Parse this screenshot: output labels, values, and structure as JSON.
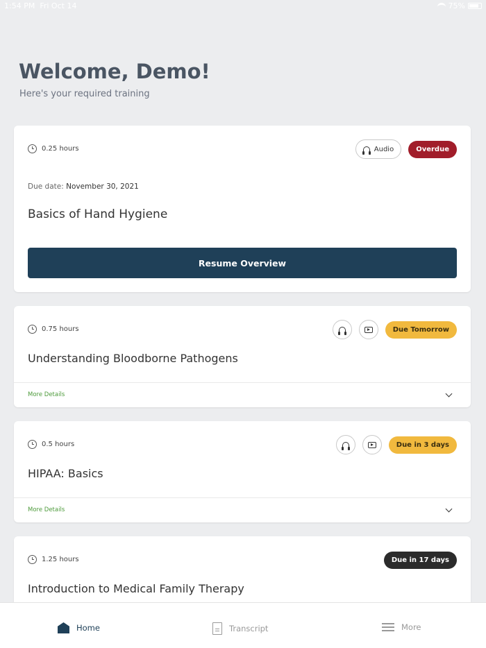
{
  "status": {
    "time": "1:54 PM",
    "date": "Fri Oct 14",
    "battery": "75%"
  },
  "header": {
    "title": "Welcome, Demo!",
    "subtitle": "Here's your required training"
  },
  "courses": [
    {
      "hours": "0.25 hours",
      "media_label": "Audio",
      "badge": "Overdue",
      "due_label": "Due date:",
      "due_date": "November 30, 2021",
      "title": "Basics of Hand Hygiene",
      "action": "Resume Overview"
    },
    {
      "hours": "0.75 hours",
      "badge": "Due Tomorrow",
      "title": "Understanding Bloodborne Pathogens",
      "details": "More Details"
    },
    {
      "hours": "0.5 hours",
      "badge": "Due in 3 days",
      "title": "HIPAA: Basics",
      "details": "More Details"
    },
    {
      "hours": "1.25 hours",
      "badge": "Due in 17 days",
      "title": "Introduction to Medical Family Therapy"
    }
  ],
  "tabs": {
    "home": "Home",
    "transcript": "Transcript",
    "more": "More"
  },
  "colors": {
    "primary": "#1f4058",
    "overdue": "#a11d2a",
    "soon": "#f1b93e",
    "later": "#2b2b2b",
    "link": "#4c9a3a"
  }
}
